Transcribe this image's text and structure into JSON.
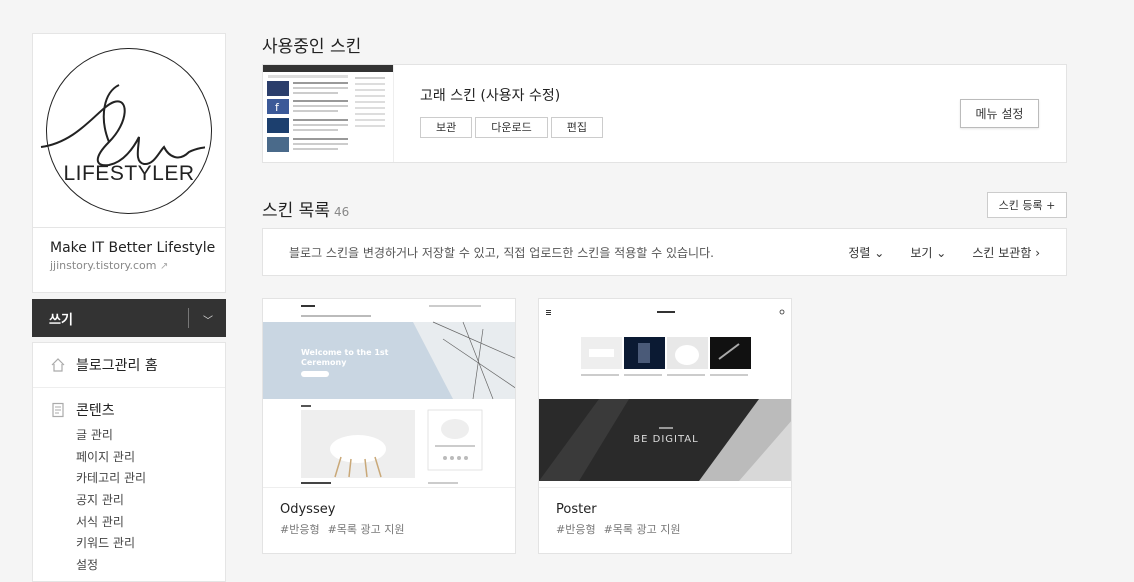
{
  "sidebar": {
    "logo_text": "LIFESTYLER",
    "blog_name": "Make IT Better Lifestyle",
    "blog_url": "jjinstory.tistory.com",
    "write_label": "쓰기",
    "home_label": "블로그관리 홈",
    "content_label": "콘텐츠",
    "content_items": [
      "글 관리",
      "페이지 관리",
      "카테고리 관리",
      "공지 관리",
      "서식 관리",
      "키워드 관리",
      "설정"
    ]
  },
  "current_skin": {
    "section_title": "사용중인 스킨",
    "name": "고래 스킨 (사용자 수정)",
    "buttons": [
      "보관",
      "다운로드",
      "편집"
    ],
    "menu_settings_label": "메뉴 설정"
  },
  "skin_list": {
    "section_title": "스킨 목록",
    "count": "46",
    "register_label": "스킨 등록 +",
    "description": "블로그 스킨을 변경하거나 저장할 수 있고, 직접 업로드한 스킨을 적용할 수 있습니다.",
    "sort_label": "정렬",
    "view_label": "보기",
    "storage_label": "스킨 보관함",
    "cards": [
      {
        "name": "Odyssey",
        "tags": [
          "#반응형",
          "#목록 광고 지원"
        ],
        "preview_heading": "Welcome to the 1st Ceremony"
      },
      {
        "name": "Poster",
        "tags": [
          "#반응형",
          "#목록 광고 지원"
        ],
        "preview_heading": "BE DIGITAL"
      }
    ]
  },
  "colors": {
    "write_bar": "#333333",
    "page_bg": "#f5f5f5",
    "accent_blue": "#3b5998"
  }
}
